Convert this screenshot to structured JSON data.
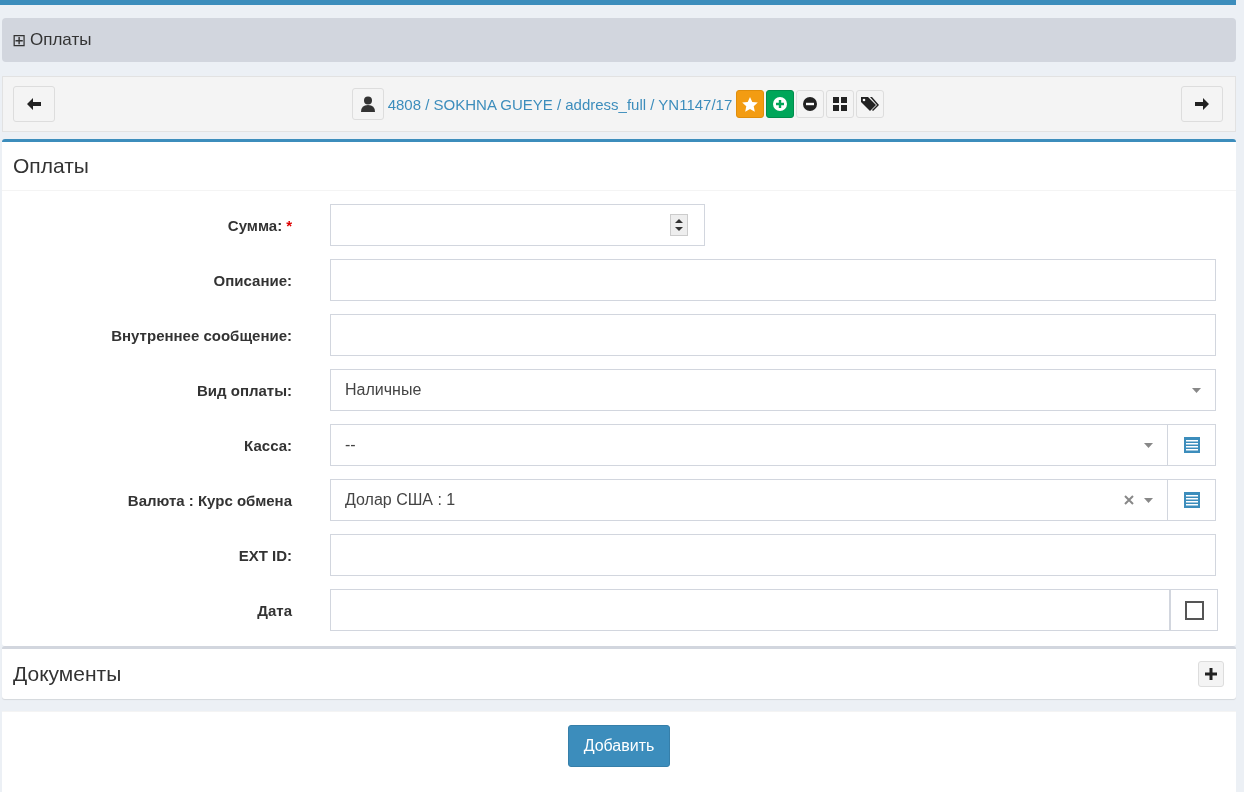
{
  "collapse_bar": {
    "icon": "⊞",
    "label": "Оплаты"
  },
  "nav": {
    "breadcrumb": "4808 / SOKHNA GUEYE / address_full / YN1147/17"
  },
  "form": {
    "title": "Оплаты",
    "fields": [
      {
        "kind": "number",
        "label": "Сумма:",
        "required_mark": "*"
      },
      {
        "kind": "text",
        "label": "Описание:"
      },
      {
        "kind": "text",
        "label": "Внутреннее сообщение:"
      },
      {
        "kind": "select",
        "label": "Вид оплаты:",
        "value": "Наличные",
        "clearable": false,
        "addon": false
      },
      {
        "kind": "select",
        "label": "Касса:",
        "value": "--",
        "clearable": false,
        "addon": true
      },
      {
        "kind": "select",
        "label": "Валюта : Курс обмена",
        "value": "Долар США : 1",
        "clearable": true,
        "addon": true
      },
      {
        "kind": "text",
        "label": "EXT ID:"
      },
      {
        "kind": "date",
        "label": "Дата",
        "checked": false
      }
    ]
  },
  "documents": {
    "title": "Документы"
  },
  "submit": "Добавить"
}
